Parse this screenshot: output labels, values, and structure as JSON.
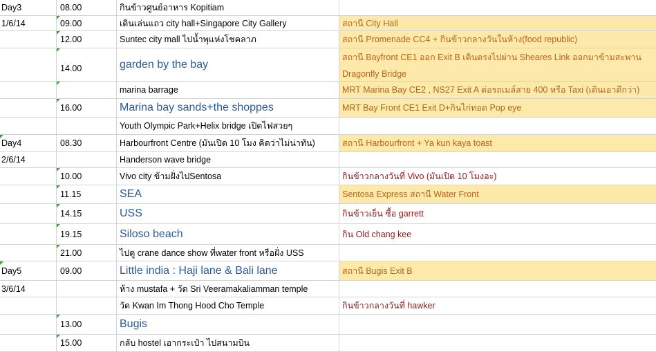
{
  "rows": [
    {
      "day": "Day3",
      "time": "08.00",
      "activity": "กินข้าวศูนย์อาหาร Kopitiam",
      "note": ""
    },
    {
      "day": "1/6/14",
      "time": "09.00",
      "activity": "เดินเล่นแถว city hall+Singapore City Gallery",
      "note": "สถานี City Hall"
    },
    {
      "day": "",
      "time": "12.00",
      "activity": "Suntec city mall ไปน้ำพุแห่งโชคลาภ",
      "note": "สถานี Promenade CC4 + กินข้าวกลางวันในห้าง(food republic)"
    },
    {
      "day": "",
      "time": "14.00",
      "activity": "garden by the bay",
      "note": "สถานี Bayfront CE1 ออก Exit B เดินตรงไปผ่าน Sheares Link ออกมาข้ามสะพาน",
      "note2": "Dragonfly Bridge"
    },
    {
      "day": "",
      "time": "",
      "activity": "marina barrage",
      "note": "MRT Marina Bay CE2 , NS27 Exit A ต่อรถเมล์สาย 400 หรือ Taxi (เดินเอาดีกว่า)"
    },
    {
      "day": "",
      "time": "16.00",
      "activity": "Marina bay sands+the shoppes",
      "note": "MRT Bay Front CE1 Exit D+กินไก่ทอด Pop eye"
    },
    {
      "day": "",
      "time": "",
      "activity": "Youth Olympic Park+Helix bridge เปิดไฟสวยๆ",
      "note": ""
    },
    {
      "day": "Day4",
      "time": "08.30",
      "activity": "Harbourfront Centre (มันเปิด 10 โมง คิดว่าไม่น่าทัน)",
      "note": "สถานี Harbourfront + Ya kun kaya toast"
    },
    {
      "day": "2/6/14",
      "time": "",
      "activity": "Handerson wave bridge",
      "note": ""
    },
    {
      "day": "",
      "time": "10.00",
      "activity": "Vivo city ข้ามฝั่งไปSentosa",
      "note": "กินข้าวกลางวันที่ Vivo (มันเปิด 10 โมงอะ)"
    },
    {
      "day": "",
      "time": "11.15",
      "activity": "SEA",
      "note": "Sentosa Express สถานี Water Front"
    },
    {
      "day": "",
      "time": "14.15",
      "activity": "USS",
      "note": "กินข้าวเย็น ซื้อ garrett"
    },
    {
      "day": "",
      "time": "19.15",
      "activity": "Siloso beach",
      "note": "กิน Old chang kee"
    },
    {
      "day": "",
      "time": "21.00",
      "activity": "ไปดู crane dance show ที่water front หรือฝั่ง USS",
      "note": ""
    },
    {
      "day": "Day5",
      "time": "09.00",
      "activity": "Little india : Haji lane & Bali lane",
      "note": "สถานี Bugis Exit B"
    },
    {
      "day": "3/6/14",
      "time": "",
      "activity": "ห้าง mustafa +  วัด Sri Veeramakaliamman temple",
      "note": ""
    },
    {
      "day": "",
      "time": "",
      "activity": "วัด Kwan Im Thong Hood Cho Temple",
      "note": "กินข้าวกลางวันที่ hawker"
    },
    {
      "day": "",
      "time": "13.00",
      "activity": "Bugis",
      "note": ""
    },
    {
      "day": "",
      "time": "15.00",
      "activity": "กลับ hostel เอากระเป๋า ไปสนามบิน",
      "note": ""
    }
  ]
}
